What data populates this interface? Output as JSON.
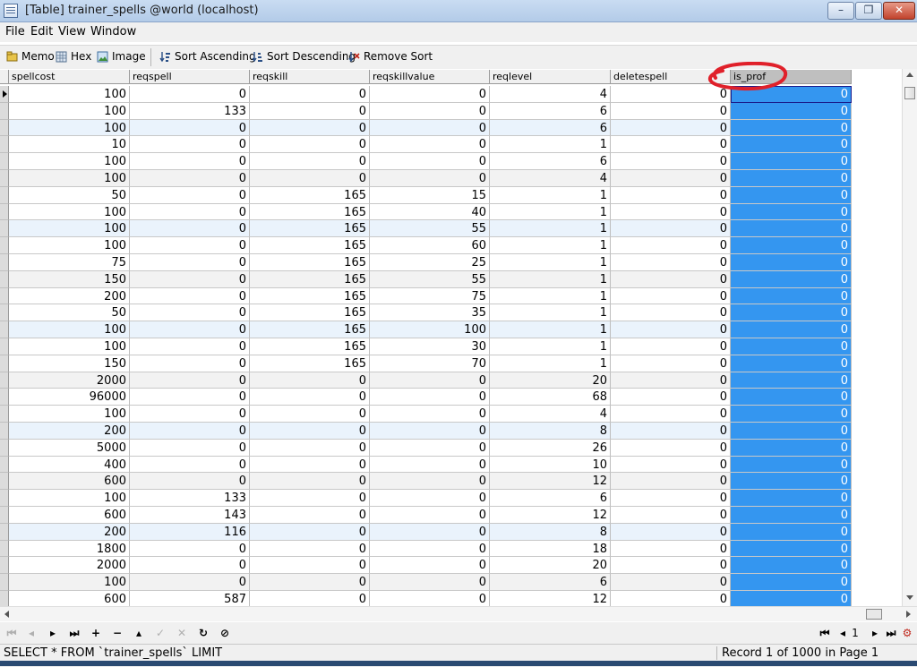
{
  "window": {
    "title": "[Table] trainer_spells @world (localhost)",
    "minimize": "–",
    "maximize": "❐",
    "close": "✕"
  },
  "menu": [
    "File",
    "Edit",
    "View",
    "Window"
  ],
  "toolbar": {
    "memo": "Memo",
    "hex": "Hex",
    "image": "Image",
    "sort_asc": "Sort Ascending",
    "sort_desc": "Sort Descending",
    "remove_sort": "Remove Sort"
  },
  "columns": [
    "spellcost",
    "reqspell",
    "reqskill",
    "reqskillvalue",
    "reqlevel",
    "deletespell",
    "is_prof"
  ],
  "rows": [
    [
      100,
      0,
      0,
      0,
      4,
      0,
      0
    ],
    [
      100,
      133,
      0,
      0,
      6,
      0,
      0
    ],
    [
      100,
      0,
      0,
      0,
      6,
      0,
      0
    ],
    [
      10,
      0,
      0,
      0,
      1,
      0,
      0
    ],
    [
      100,
      0,
      0,
      0,
      6,
      0,
      0
    ],
    [
      100,
      0,
      0,
      0,
      4,
      0,
      0
    ],
    [
      50,
      0,
      165,
      15,
      1,
      0,
      0
    ],
    [
      100,
      0,
      165,
      40,
      1,
      0,
      0
    ],
    [
      100,
      0,
      165,
      55,
      1,
      0,
      0
    ],
    [
      100,
      0,
      165,
      60,
      1,
      0,
      0
    ],
    [
      75,
      0,
      165,
      25,
      1,
      0,
      0
    ],
    [
      150,
      0,
      165,
      55,
      1,
      0,
      0
    ],
    [
      200,
      0,
      165,
      75,
      1,
      0,
      0
    ],
    [
      50,
      0,
      165,
      35,
      1,
      0,
      0
    ],
    [
      100,
      0,
      165,
      100,
      1,
      0,
      0
    ],
    [
      100,
      0,
      165,
      30,
      1,
      0,
      0
    ],
    [
      150,
      0,
      165,
      70,
      1,
      0,
      0
    ],
    [
      2000,
      0,
      0,
      0,
      20,
      0,
      0
    ],
    [
      96000,
      0,
      0,
      0,
      68,
      0,
      0
    ],
    [
      100,
      0,
      0,
      0,
      4,
      0,
      0
    ],
    [
      200,
      0,
      0,
      0,
      8,
      0,
      0
    ],
    [
      5000,
      0,
      0,
      0,
      26,
      0,
      0
    ],
    [
      400,
      0,
      0,
      0,
      10,
      0,
      0
    ],
    [
      600,
      0,
      0,
      0,
      12,
      0,
      0
    ],
    [
      100,
      133,
      0,
      0,
      6,
      0,
      0
    ],
    [
      600,
      143,
      0,
      0,
      12,
      0,
      0
    ],
    [
      200,
      116,
      0,
      0,
      8,
      0,
      0
    ],
    [
      1800,
      0,
      0,
      0,
      18,
      0,
      0
    ],
    [
      2000,
      0,
      0,
      0,
      20,
      0,
      0
    ],
    [
      100,
      0,
      0,
      0,
      6,
      0,
      0
    ],
    [
      600,
      587,
      0,
      0,
      12,
      0,
      0
    ]
  ],
  "navigator": {
    "page_number": "1"
  },
  "status": {
    "sql": "SELECT * FROM `trainer_spells` LIMIT",
    "record": "Record 1 of 1000 in Page 1"
  },
  "colors": {
    "selected_column": "#3496f0",
    "annotation_circle": "#e0202a"
  }
}
